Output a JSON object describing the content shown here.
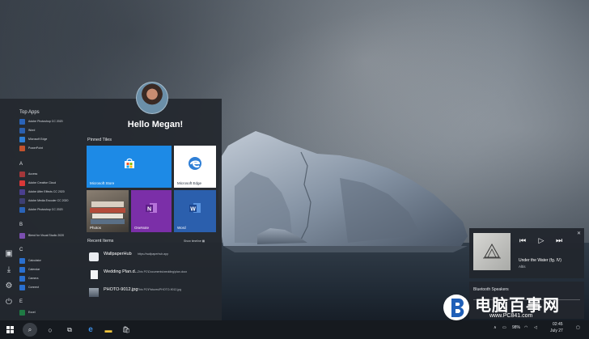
{
  "start_menu": {
    "greeting": "Hello Megan!",
    "top_apps_header": "Top Apps",
    "top_apps": [
      {
        "label": "Adobe Photoshop CC 2020",
        "color": "#2a63b8"
      },
      {
        "label": "Word",
        "color": "#2b5fad"
      },
      {
        "label": "Microsoft Edge",
        "color": "#2f7fd6"
      },
      {
        "label": "PowerPoint",
        "color": "#c2522d"
      }
    ],
    "sections": [
      {
        "letter": "A",
        "apps": [
          {
            "label": "Access",
            "color": "#a4373a"
          },
          {
            "label": "Adobe Creative Cloud",
            "color": "#d93838"
          },
          {
            "label": "Adobe After Effects CC 2020",
            "color": "#4a3f8f"
          },
          {
            "label": "Adobe Media Encoder CC 2020",
            "color": "#3d3f73"
          },
          {
            "label": "Adobe Photoshop CC 2020",
            "color": "#2a63b8"
          }
        ]
      },
      {
        "letter": "B",
        "apps": [
          {
            "label": "Blend for Visual Studio 2020",
            "color": "#7b4fb0"
          }
        ]
      },
      {
        "letter": "C",
        "apps": [
          {
            "label": "Calculator",
            "color": "#2a6fcf"
          },
          {
            "label": "Calendar",
            "color": "#2a6fcf"
          },
          {
            "label": "Camera",
            "color": "#2a6fcf"
          },
          {
            "label": "Connect",
            "color": "#2a6fcf"
          }
        ]
      },
      {
        "letter": "E",
        "apps": [
          {
            "label": "Excel",
            "color": "#1f7a44"
          }
        ]
      }
    ],
    "pinned_header": "Pinned Tiles",
    "tiles": [
      {
        "label": "Microsoft Store",
        "bg": "#1d8ae6"
      },
      {
        "label": "Microsoft Edge",
        "bg": "#ffffff"
      },
      {
        "label": "Photos",
        "bg": "#6b6259"
      },
      {
        "label": "OneNote",
        "bg": "#7b2fa8"
      },
      {
        "label": "Word",
        "bg": "#2b5fad"
      }
    ],
    "recent_header": "Recent Items",
    "show_timeline": "Show timeline",
    "recent": [
      {
        "name": "WallpaperHub",
        "path": "https://wallpaperhub.app"
      },
      {
        "name": "Wedding Plan.d...",
        "path": "This PC\\Documents\\wedding\\plan.docx"
      },
      {
        "name": "PHOTO-9012.jpg",
        "path": "This PC\\Pictures\\PHOTO-9012.jpg"
      }
    ]
  },
  "media": {
    "title": "Under the Water (fg. IV)",
    "artist": "Altis",
    "prev_icon": "previous-icon",
    "play_icon": "play-icon",
    "next_icon": "next-icon"
  },
  "audio": {
    "device": "Bluetooth Speakers"
  },
  "taskbar": {
    "battery": "98%",
    "time": "02:45",
    "date": "July 27"
  },
  "watermark": {
    "title": "电脑百事网",
    "url": "www.PC841.com"
  }
}
